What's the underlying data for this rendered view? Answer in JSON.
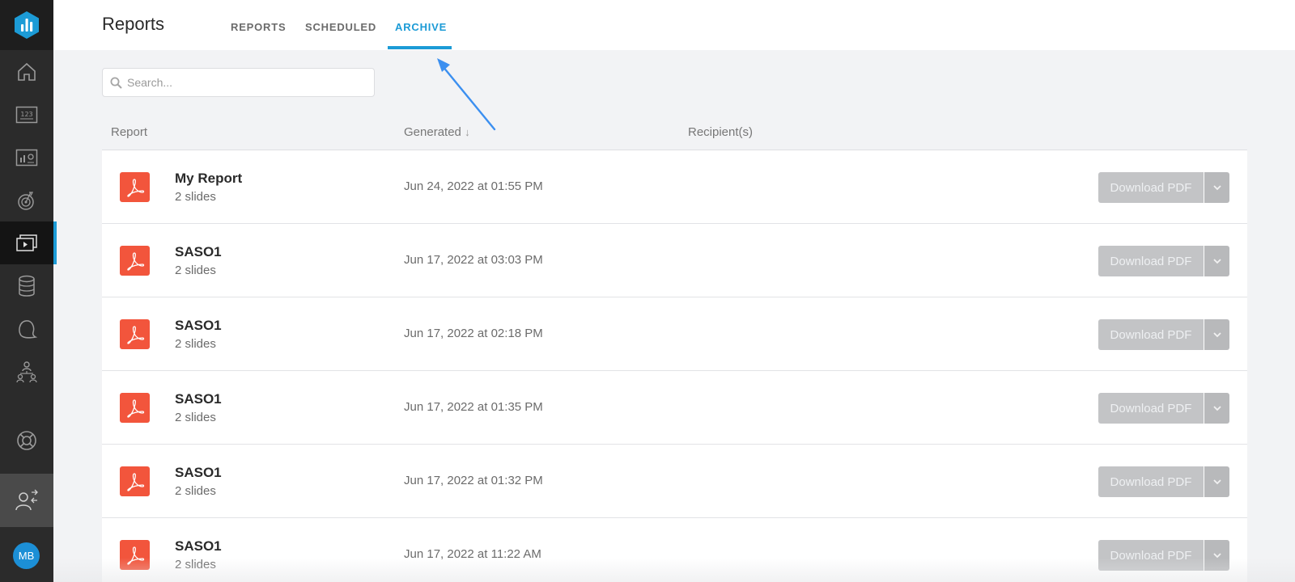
{
  "sidebar": {
    "logo": "bar-chart-logo",
    "items": [
      {
        "icon": "home-icon",
        "active": false
      },
      {
        "icon": "number-metric-icon",
        "active": false
      },
      {
        "icon": "dashboard-icon",
        "active": false
      },
      {
        "icon": "goals-icon",
        "active": false
      },
      {
        "icon": "reports-icon",
        "active": true
      },
      {
        "icon": "database-icon",
        "active": false
      },
      {
        "icon": "alerts-icon",
        "active": false
      },
      {
        "icon": "team-icon",
        "active": false
      }
    ],
    "footer": [
      {
        "icon": "help-icon"
      },
      {
        "icon": "switch-user-icon"
      }
    ],
    "avatar_initials": "MB"
  },
  "header": {
    "title": "Reports",
    "tabs": [
      {
        "label": "REPORTS",
        "active": false
      },
      {
        "label": "SCHEDULED",
        "active": false
      },
      {
        "label": "ARCHIVE",
        "active": true
      }
    ]
  },
  "search": {
    "placeholder": "Search..."
  },
  "table": {
    "columns": {
      "report": "Report",
      "generated": "Generated",
      "sort_indicator": "↓",
      "recipients": "Recipient(s)"
    },
    "rows": [
      {
        "name": "My Report",
        "slides": "2 slides",
        "generated": "Jun 24, 2022 at 01:55 PM",
        "action": "Download PDF"
      },
      {
        "name": "SASO1",
        "slides": "2 slides",
        "generated": "Jun 17, 2022 at 03:03 PM",
        "action": "Download PDF"
      },
      {
        "name": "SASO1",
        "slides": "2 slides",
        "generated": "Jun 17, 2022 at 02:18 PM",
        "action": "Download PDF"
      },
      {
        "name": "SASO1",
        "slides": "2 slides",
        "generated": "Jun 17, 2022 at 01:35 PM",
        "action": "Download PDF"
      },
      {
        "name": "SASO1",
        "slides": "2 slides",
        "generated": "Jun 17, 2022 at 01:32 PM",
        "action": "Download PDF"
      },
      {
        "name": "SASO1",
        "slides": "2 slides",
        "generated": "Jun 17, 2022 at 11:22 AM",
        "action": "Download PDF"
      }
    ]
  },
  "colors": {
    "accent": "#1c9bd6",
    "pdf": "#f2553c",
    "sidebar": "#2b2b2b",
    "annotation_arrow": "#3b8ff0"
  }
}
